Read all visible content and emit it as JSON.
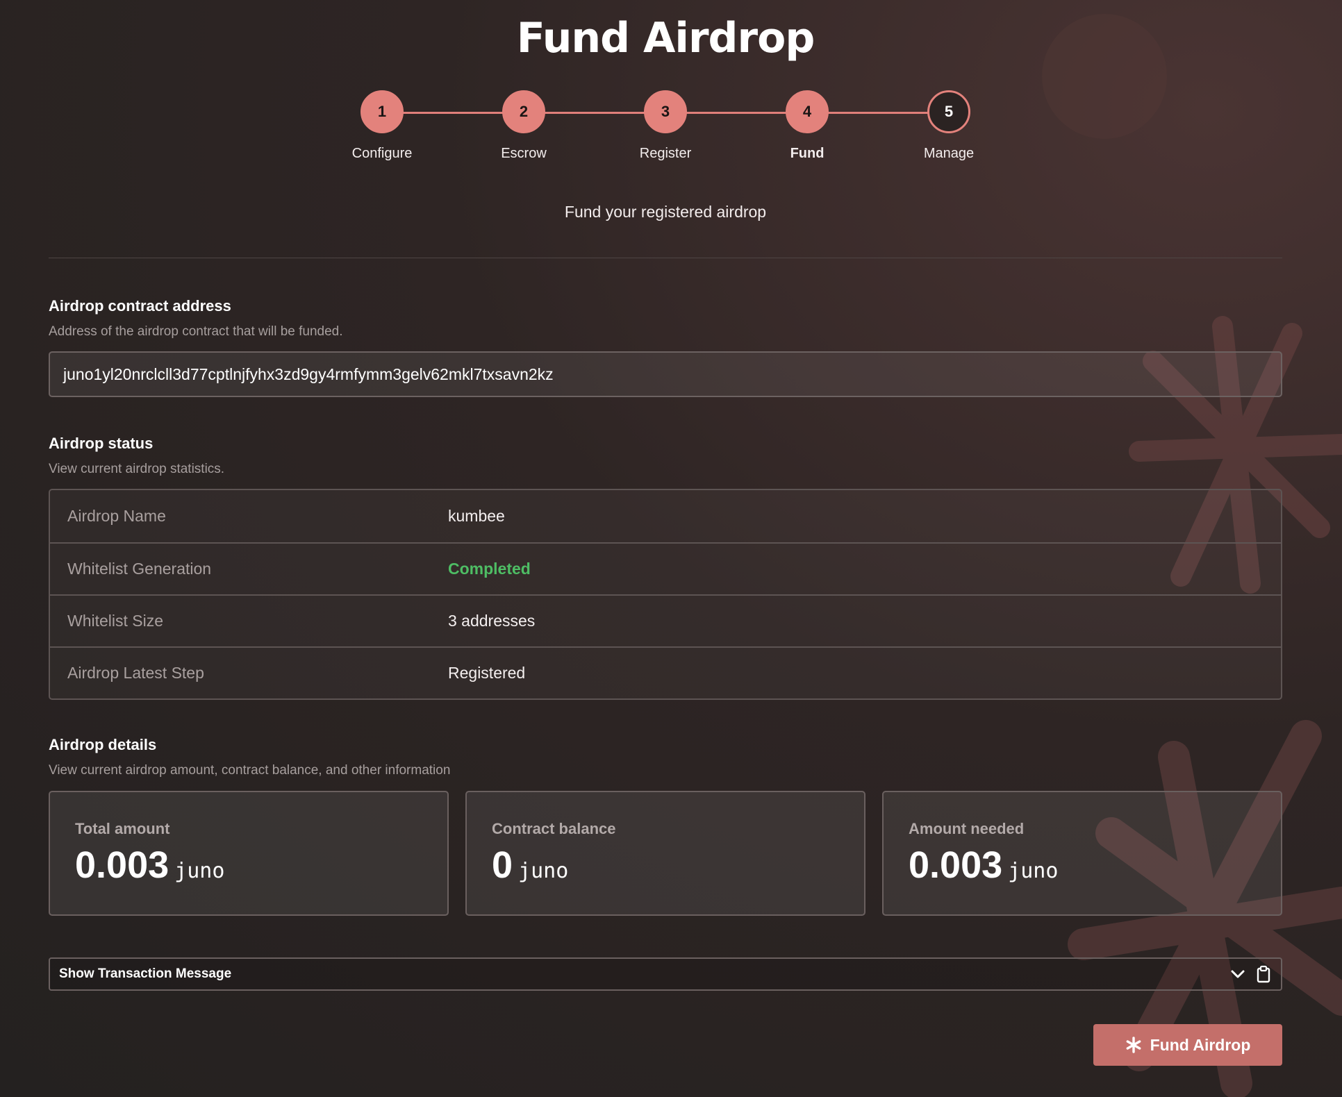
{
  "page": {
    "title": "Fund Airdrop",
    "subtitle": "Fund your registered airdrop"
  },
  "steps": [
    {
      "number": "1",
      "label": "Configure"
    },
    {
      "number": "2",
      "label": "Escrow"
    },
    {
      "number": "3",
      "label": "Register"
    },
    {
      "number": "4",
      "label": "Fund"
    },
    {
      "number": "5",
      "label": "Manage"
    }
  ],
  "contract": {
    "title": "Airdrop contract address",
    "description": "Address of the airdrop contract that will be funded.",
    "value": "juno1yl20nrclcll3d77cptlnjfyhx3zd9gy4rmfymm3gelv62mkl7txsavn2kz"
  },
  "status": {
    "title": "Airdrop status",
    "description": "View current airdrop statistics.",
    "rows": [
      {
        "key": "Airdrop Name",
        "value": "kumbee"
      },
      {
        "key": "Whitelist Generation",
        "value": "Completed"
      },
      {
        "key": "Whitelist Size",
        "value": "3 addresses"
      },
      {
        "key": "Airdrop Latest Step",
        "value": "Registered"
      }
    ]
  },
  "details": {
    "title": "Airdrop details",
    "description": "View current airdrop amount, contract balance, and other information",
    "cards": [
      {
        "label": "Total amount",
        "value": "0.003",
        "unit": "juno"
      },
      {
        "label": "Contract balance",
        "value": "0",
        "unit": "juno"
      },
      {
        "label": "Amount needed",
        "value": "0.003",
        "unit": "juno"
      }
    ]
  },
  "tx": {
    "label": "Show Transaction Message"
  },
  "actions": {
    "fund_label": "Fund Airdrop"
  },
  "colors": {
    "accent": "#e3827c",
    "button": "#c46f6a",
    "success": "#4ebd64"
  },
  "icons": {
    "toggle": "chevron-down-icon",
    "copy": "clipboard-icon",
    "button": "asterisk-icon"
  }
}
